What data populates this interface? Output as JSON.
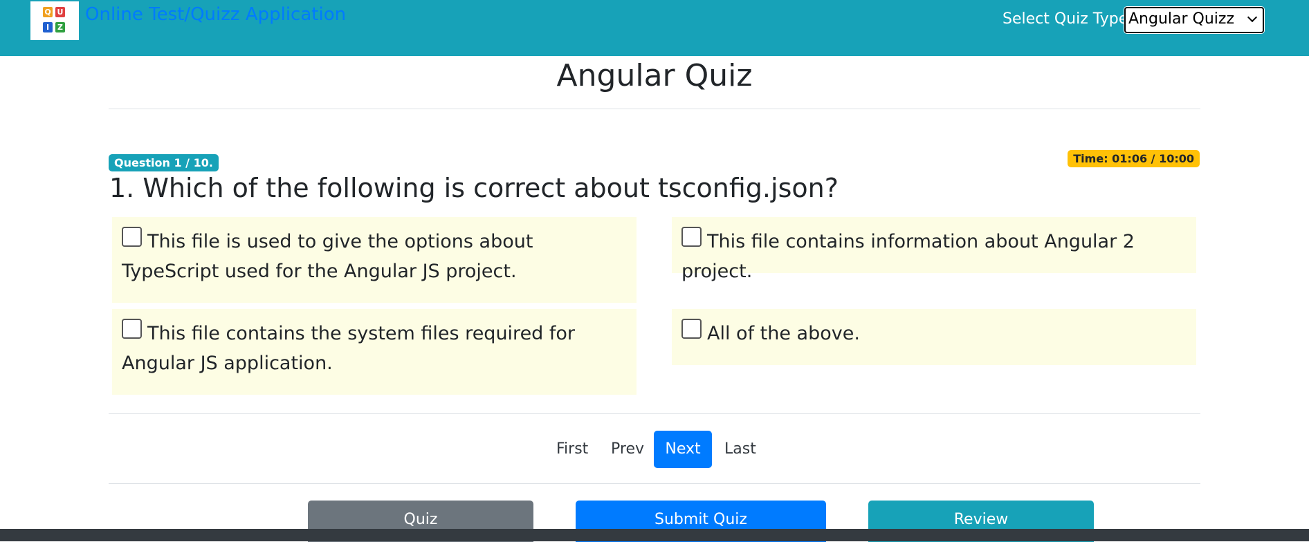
{
  "header": {
    "app_title": "Online Test/Quizz Application",
    "quiz_type_label": "Select Quiz Type:",
    "quiz_type_selected": "Angular Quizz",
    "logo_letters": [
      "Q",
      "U",
      "I",
      "Z"
    ]
  },
  "page": {
    "title": "Angular Quiz"
  },
  "question": {
    "counter": "Question 1 / 10.",
    "timer": "Time: 01:06 / 10:00",
    "text": "1. Which of the following is correct about tsconfig.json?",
    "options": [
      "This file is used to give the options about TypeScript used for the Angular JS project.",
      "This file contains information about Angular 2 project.",
      "This file contains the system files required for Angular JS application.",
      "All of the above."
    ]
  },
  "pagination": {
    "first": "First",
    "prev": "Prev",
    "next": "Next",
    "last": "Last"
  },
  "actions": {
    "quiz": "Quiz",
    "submit": "Submit Quiz",
    "review": "Review"
  },
  "colors": {
    "navbar": "#17a2b8",
    "primary": "#007bff",
    "secondary": "#6c757d",
    "info": "#17a2b8",
    "warning": "#ffc107",
    "option_bg": "#fdfde4",
    "footer": "#343a40"
  }
}
